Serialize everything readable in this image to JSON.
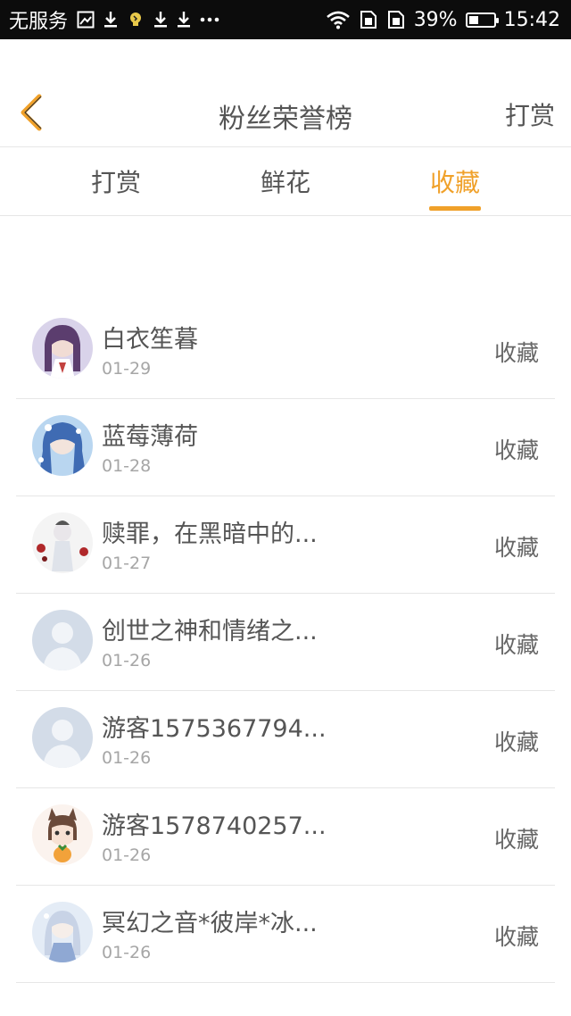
{
  "status_bar": {
    "carrier": "无服务",
    "battery_percent": "39%",
    "battery_level": 0.39,
    "time": "15:42",
    "icons": [
      "image-icon",
      "download-icon",
      "bulb-icon",
      "download-icon",
      "download-icon",
      "more-icon",
      "wifi-icon",
      "sim-icon",
      "sim-icon",
      "battery-icon"
    ]
  },
  "header": {
    "title": "粉丝荣誉榜",
    "action_label": "打赏",
    "back_icon": "chevron-left-icon",
    "accent_color": "#f0a12a"
  },
  "tabs": [
    {
      "label": "打赏",
      "active": false
    },
    {
      "label": "鲜花",
      "active": false
    },
    {
      "label": "收藏",
      "active": true
    }
  ],
  "list": [
    {
      "name": "白衣笙暮",
      "date": "01-29",
      "action": "收藏",
      "avatar": "anime-avatar"
    },
    {
      "name": "蓝莓薄荷",
      "date": "01-28",
      "action": "收藏",
      "avatar": "anime-avatar"
    },
    {
      "name": "赎罪，在黑暗中的...",
      "date": "01-27",
      "action": "收藏",
      "avatar": "anime-avatar"
    },
    {
      "name": "创世之神和情绪之...",
      "date": "01-26",
      "action": "收藏",
      "avatar": "default-avatar"
    },
    {
      "name": "游客1575367794...",
      "date": "01-26",
      "action": "收藏",
      "avatar": "default-avatar"
    },
    {
      "name": "游客1578740257...",
      "date": "01-26",
      "action": "收藏",
      "avatar": "anime-avatar"
    },
    {
      "name": "冥幻之音*彼岸*冰...",
      "date": "01-26",
      "action": "收藏",
      "avatar": "anime-avatar"
    }
  ]
}
